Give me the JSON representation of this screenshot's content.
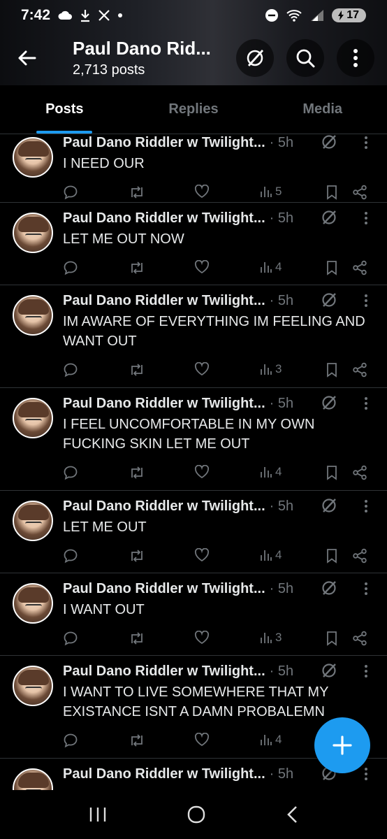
{
  "status": {
    "time": "7:42",
    "battery": "17",
    "signal_label": "5"
  },
  "header": {
    "name": "Paul Dano Rid...",
    "post_count": "2,713 posts"
  },
  "tabs": [
    {
      "label": "Posts",
      "active": true
    },
    {
      "label": "Replies",
      "active": false
    },
    {
      "label": "Media",
      "active": false
    }
  ],
  "posts": [
    {
      "author": "Paul Dano Riddler w Twilight...",
      "time": "· 5h",
      "text": "I NEED OUR",
      "views": "5"
    },
    {
      "author": "Paul Dano Riddler w Twilight...",
      "time": "· 5h",
      "text": "LET ME OUT NOW",
      "views": "4"
    },
    {
      "author": "Paul Dano Riddler w Twilight...",
      "time": "· 5h",
      "text": "IM AWARE OF EVERYTHING IM FEELING AND WANT OUT",
      "views": "3"
    },
    {
      "author": "Paul Dano Riddler w Twilight...",
      "time": "· 5h",
      "text": "I FEEL UNCOMFORTABLE IN MY OWN FUCKING SKIN LET ME OUT",
      "views": "4"
    },
    {
      "author": "Paul Dano Riddler w Twilight...",
      "time": "· 5h",
      "text": "LET ME OUT",
      "views": "4"
    },
    {
      "author": "Paul Dano Riddler w Twilight...",
      "time": "· 5h",
      "text": "I WANT OUT",
      "views": "3"
    },
    {
      "author": "Paul Dano Riddler w Twilight...",
      "time": "· 5h",
      "text": "I WANT TO LIVE SOMEWHERE THAT MY EXISTANCE ISNT A DAMN PROBALEMN",
      "views": "4"
    },
    {
      "author": "Paul Dano Riddler w Twilight...",
      "time": "· 5h",
      "text": "",
      "views": ""
    }
  ],
  "icons": {
    "back": "arrow-left-icon",
    "grok": "grok-icon",
    "search": "search-icon",
    "more": "more-vertical-icon",
    "reply": "reply-icon",
    "repost": "repost-icon",
    "like": "heart-icon",
    "views": "views-icon",
    "bookmark": "bookmark-icon",
    "share": "share-icon",
    "compose": "plus-icon"
  },
  "colors": {
    "accent": "#1d9bf0",
    "muted": "#71767b",
    "divider": "#2f3336"
  }
}
